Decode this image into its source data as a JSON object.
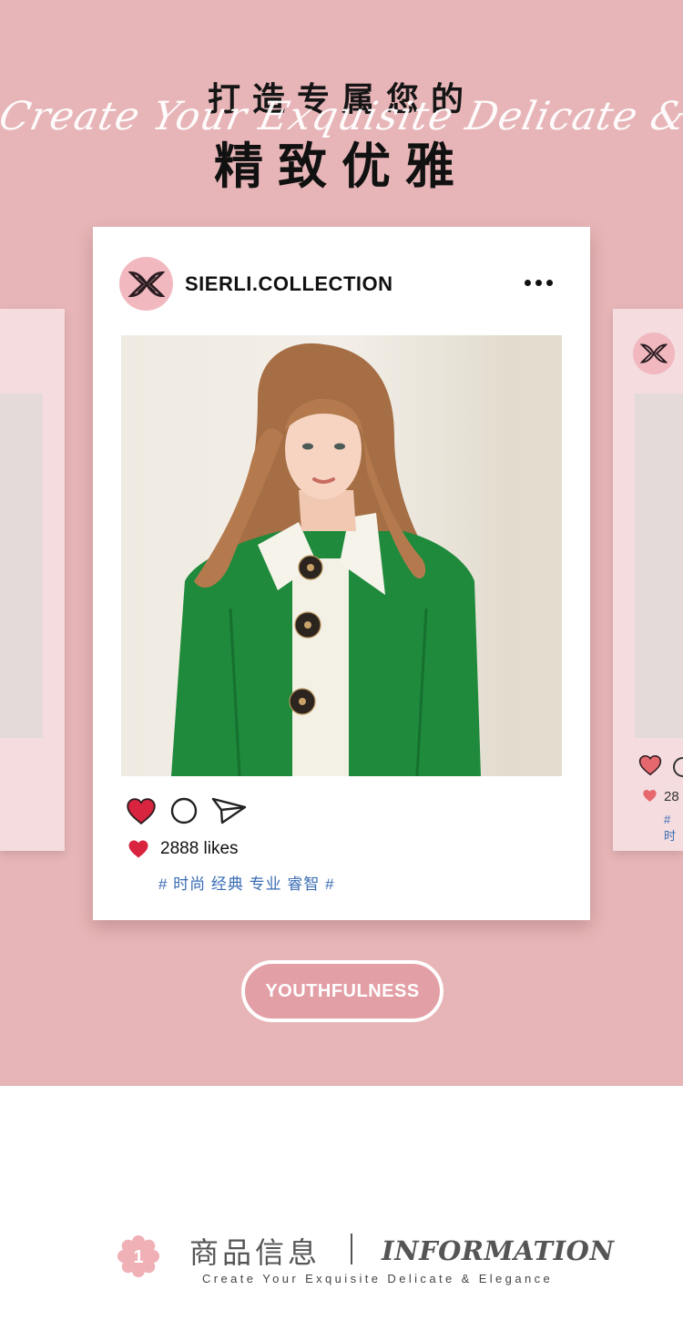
{
  "hero": {
    "title_line1": "打造专属您的",
    "script_text": "Create Your Exquisite Delicate & Elegance",
    "title_line2": "精致优雅",
    "background_color": "#e7b5b7"
  },
  "post": {
    "account_name": "SIERLI.COLLECTION",
    "avatar_icon": "sierli-logo-icon",
    "more_icon": "more-dots-icon",
    "actions": [
      "heart-icon",
      "comment-icon",
      "share-icon"
    ],
    "likes": "2888 likes",
    "tags": "# 时尚 经典 专业 睿智 #",
    "side_likes_fragment": "28",
    "side_tags_fragment": "# 时"
  },
  "cta": {
    "label": "YOUTHFULNESS"
  },
  "info": {
    "badge_number": "1",
    "title_cn": "商品信息",
    "title_en": "INFORMATION",
    "subtitle": "Create Your Exquisite Delicate & Elegance"
  },
  "colors": {
    "accent_pink": "#e39fa6",
    "heart_red": "#d8243f",
    "tag_blue": "#3a6cb3"
  }
}
